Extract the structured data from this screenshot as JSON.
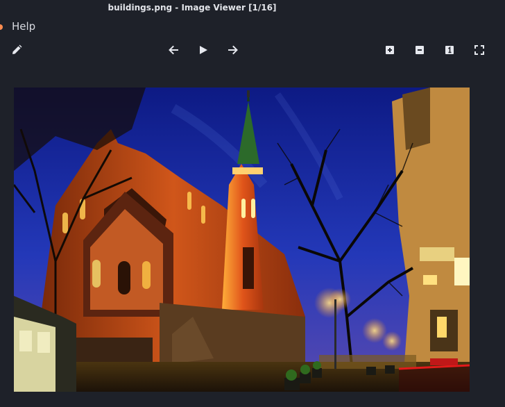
{
  "window": {
    "title": "buildings.png - Image Viewer [1/16]"
  },
  "menu": {
    "items": [
      {
        "label": "Help"
      }
    ]
  },
  "toolbar": {
    "edit_icon": "pencil-icon",
    "prev_icon": "arrow-left-icon",
    "play_icon": "play-icon",
    "next_icon": "arrow-right-icon",
    "zoom_in_icon": "plus-square-icon",
    "zoom_out_icon": "minus-square-icon",
    "actual_size_icon": "one-square-icon",
    "fit_icon": "fullscreen-icon"
  },
  "image": {
    "subject": "church with lit gothic spire at night beside bare trees and street",
    "colors": {
      "sky": "#1a2a9c",
      "facade": "#c44a12",
      "glow": "#ffb23a"
    }
  },
  "theme": {
    "background": "#1e2129",
    "accent": "#ff8d50",
    "icon": "#e6e8ee"
  }
}
